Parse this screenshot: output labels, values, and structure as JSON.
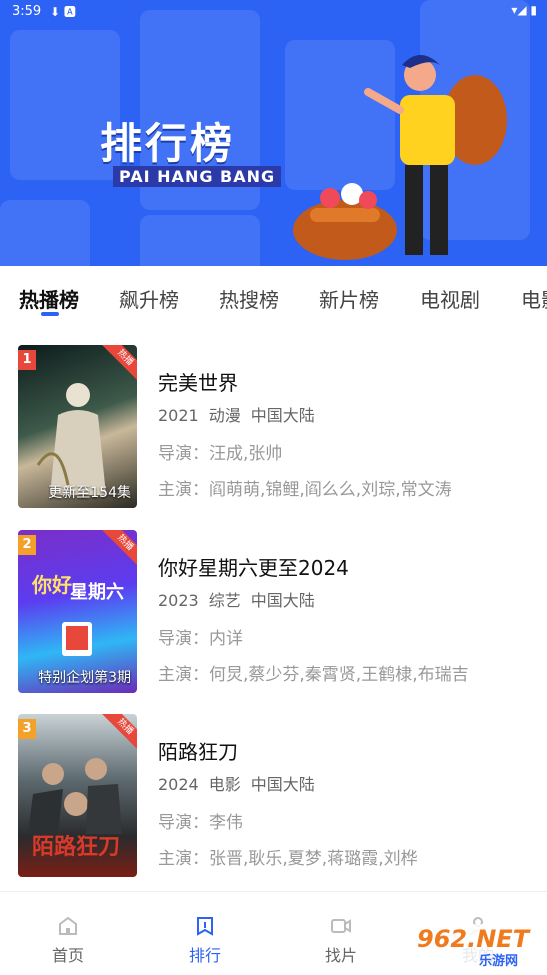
{
  "status_bar": {
    "time": "3:59",
    "left_icons": "⬇ 🅰",
    "right_icons": "▾◢ ▮"
  },
  "banner": {
    "title": "排行榜",
    "subtitle": "PAI HANG BANG"
  },
  "tabs": [
    "热播榜",
    "飙升榜",
    "热搜榜",
    "新片榜",
    "电视剧",
    "电影"
  ],
  "active_tab": 0,
  "items": [
    {
      "rank": "1",
      "hot": "热播",
      "caption": "更新至154集",
      "title": "完美世界",
      "year": "2021",
      "genre": "动漫",
      "region": "中国大陆",
      "director": "导演：汪成,张帅",
      "cast": "主演：阎萌萌,锦鲤,阎么么,刘琮,常文涛",
      "rank_color": "#e8483b"
    },
    {
      "rank": "2",
      "hot": "热播",
      "caption": "特别企划第3期",
      "title": "你好星期六更至2024",
      "year": "2023",
      "genre": "综艺",
      "region": "中国大陆",
      "director": "导演：内详",
      "cast": "主演：何炅,蔡少芬,秦霄贤,王鹤棣,布瑞吉",
      "rank_color": "#f3a12b"
    },
    {
      "rank": "3",
      "hot": "热播",
      "caption": "",
      "title": "陌路狂刀",
      "year": "2024",
      "genre": "电影",
      "region": "中国大陆",
      "director": "导演：李伟",
      "cast": "主演：张晋,耿乐,夏梦,蒋璐霞,刘桦",
      "rank_color": "#f3a12b"
    }
  ],
  "bottom_nav": [
    {
      "label": "首页",
      "icon": "home-icon"
    },
    {
      "label": "排行",
      "icon": "ranking-icon"
    },
    {
      "label": "找片",
      "icon": "video-icon"
    },
    {
      "label": "我的",
      "icon": "user-icon"
    }
  ],
  "active_nav": 1,
  "watermark": {
    "main": "962.NET",
    "sub": "乐游网"
  },
  "colors": {
    "accent": "#2d63f5",
    "hot": "#e8483b"
  }
}
